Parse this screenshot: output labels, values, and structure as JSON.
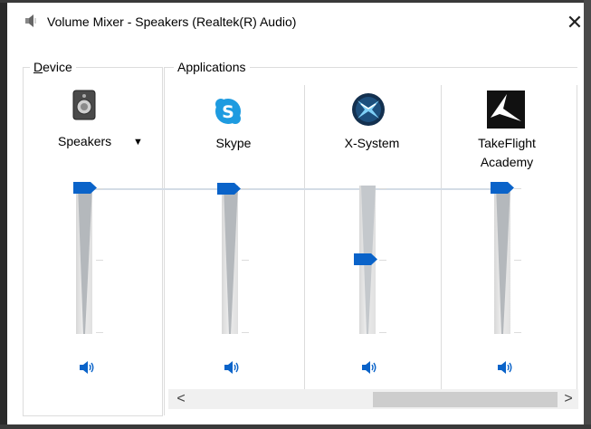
{
  "window": {
    "title": "Volume Mixer - Speakers (Realtek(R) Audio)",
    "close_glyph": "✕",
    "icon": "speaker-small-icon"
  },
  "device": {
    "group_label_first": "D",
    "group_label_rest": "evice",
    "name": "Speakers",
    "dropdown_glyph": "▼",
    "icon": "speaker-device-icon",
    "volume_percent": 100,
    "mute_icon": "volume-icon"
  },
  "applications": {
    "group_label": "Applications",
    "items": [
      {
        "name": "Skype",
        "icon": "skype-icon",
        "volume_percent": 100
      },
      {
        "name": "X-System",
        "icon": "x-system-icon",
        "volume_percent": 50
      },
      {
        "name": "TakeFlight\nAcademy",
        "icon": "takeflight-icon",
        "volume_percent": 100
      }
    ]
  },
  "scrollbar": {
    "left_glyph": "<",
    "right_glyph": ">"
  },
  "colors": {
    "accent": "#0a63c9",
    "skype": "#1e9be0",
    "frame": "#dcdcdc"
  }
}
